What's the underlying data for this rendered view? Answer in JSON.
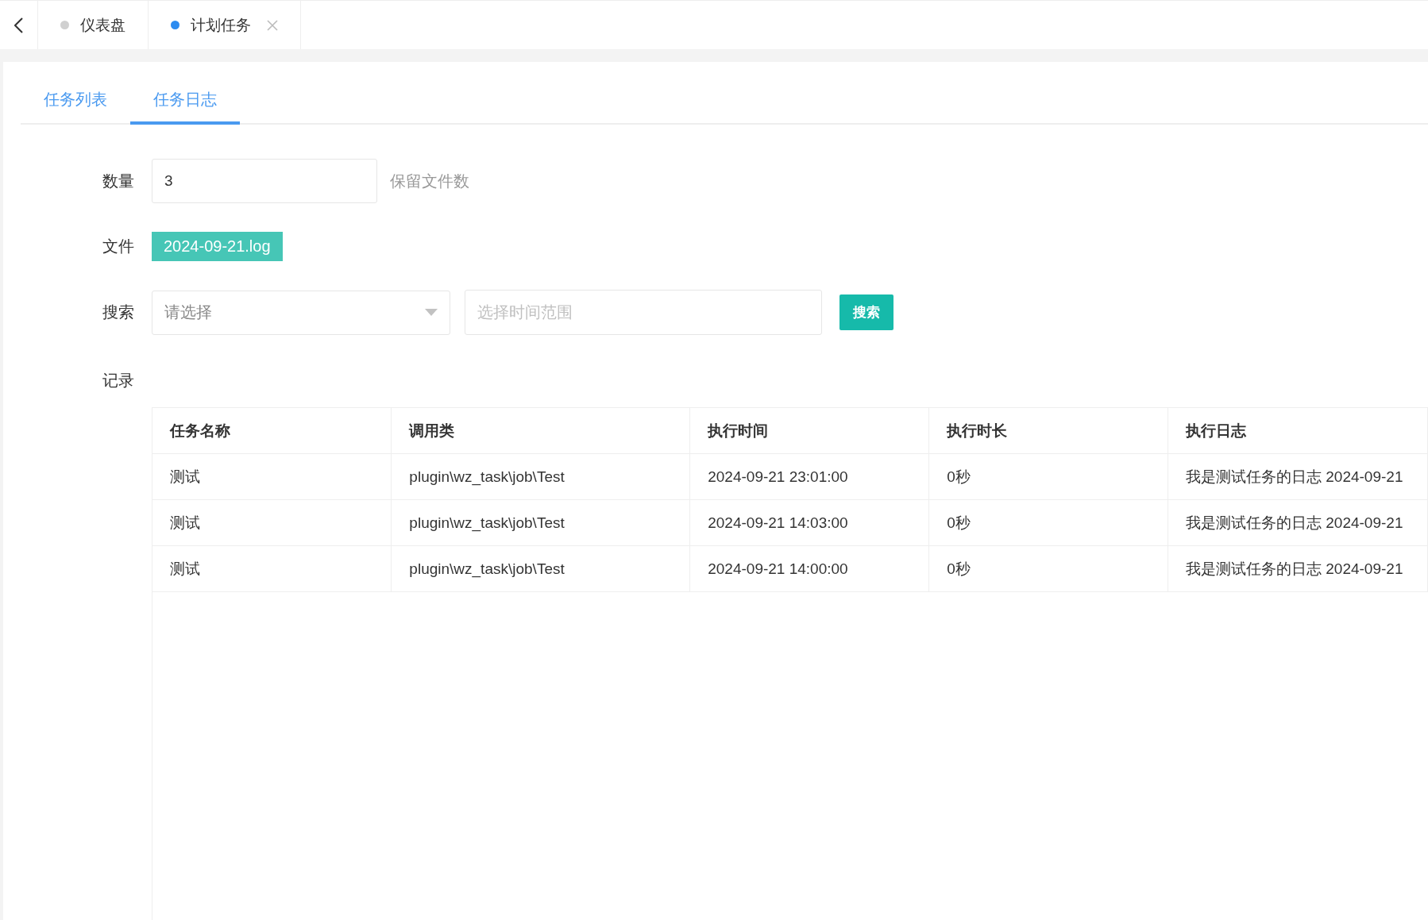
{
  "page_tabs": [
    {
      "label": "仪表盘",
      "selected": false,
      "closable": false
    },
    {
      "label": "计划任务",
      "selected": true,
      "closable": true
    }
  ],
  "section_tabs": [
    {
      "label": "任务列表",
      "selected": false
    },
    {
      "label": "任务日志",
      "selected": true
    }
  ],
  "form": {
    "count": {
      "label": "数量",
      "value": "3",
      "hint": "保留文件数"
    },
    "files": {
      "label": "文件",
      "items": [
        "2024-09-21.log"
      ]
    },
    "search": {
      "label": "搜索",
      "select": {
        "placeholder": "请选择"
      },
      "date_range": {
        "placeholder": "选择时间范围"
      },
      "button": "搜索"
    },
    "records_label": "记录"
  },
  "table": {
    "columns": [
      "任务名称",
      "调用类",
      "执行时间",
      "执行时长",
      "执行日志"
    ],
    "rows": [
      [
        "测试",
        "plugin\\wz_task\\job\\Test",
        "2024-09-21 23:01:00",
        "0秒",
        "我是测试任务的日志 2024-09-21"
      ],
      [
        "测试",
        "plugin\\wz_task\\job\\Test",
        "2024-09-21 14:03:00",
        "0秒",
        "我是测试任务的日志 2024-09-21"
      ],
      [
        "测试",
        "plugin\\wz_task\\job\\Test",
        "2024-09-21 14:00:00",
        "0秒",
        "我是测试任务的日志 2024-09-21"
      ]
    ]
  }
}
